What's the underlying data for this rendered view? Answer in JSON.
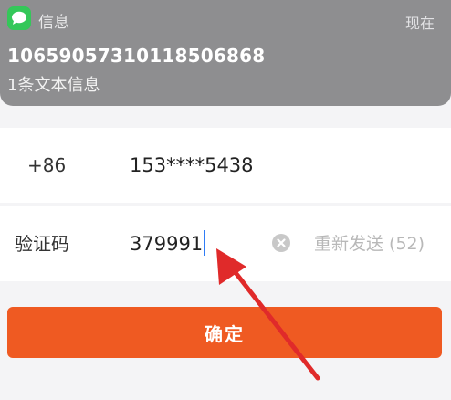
{
  "notification": {
    "app_name": "信息",
    "time": "现在",
    "sender": "10659057310118506868",
    "preview": "1条文本信息",
    "icon": "messages-icon"
  },
  "form": {
    "phone": {
      "country_code": "+86",
      "number": "153****5438"
    },
    "code": {
      "label": "验证码",
      "value": "379991",
      "clear_icon": "clear-icon",
      "resend": "重新发送 (52)"
    }
  },
  "confirm_button": "确定",
  "colors": {
    "accent": "#ef5a22",
    "annotation_arrow": "#e02a2a",
    "caret": "#2f7cf6",
    "messages_icon": "#34c759"
  }
}
